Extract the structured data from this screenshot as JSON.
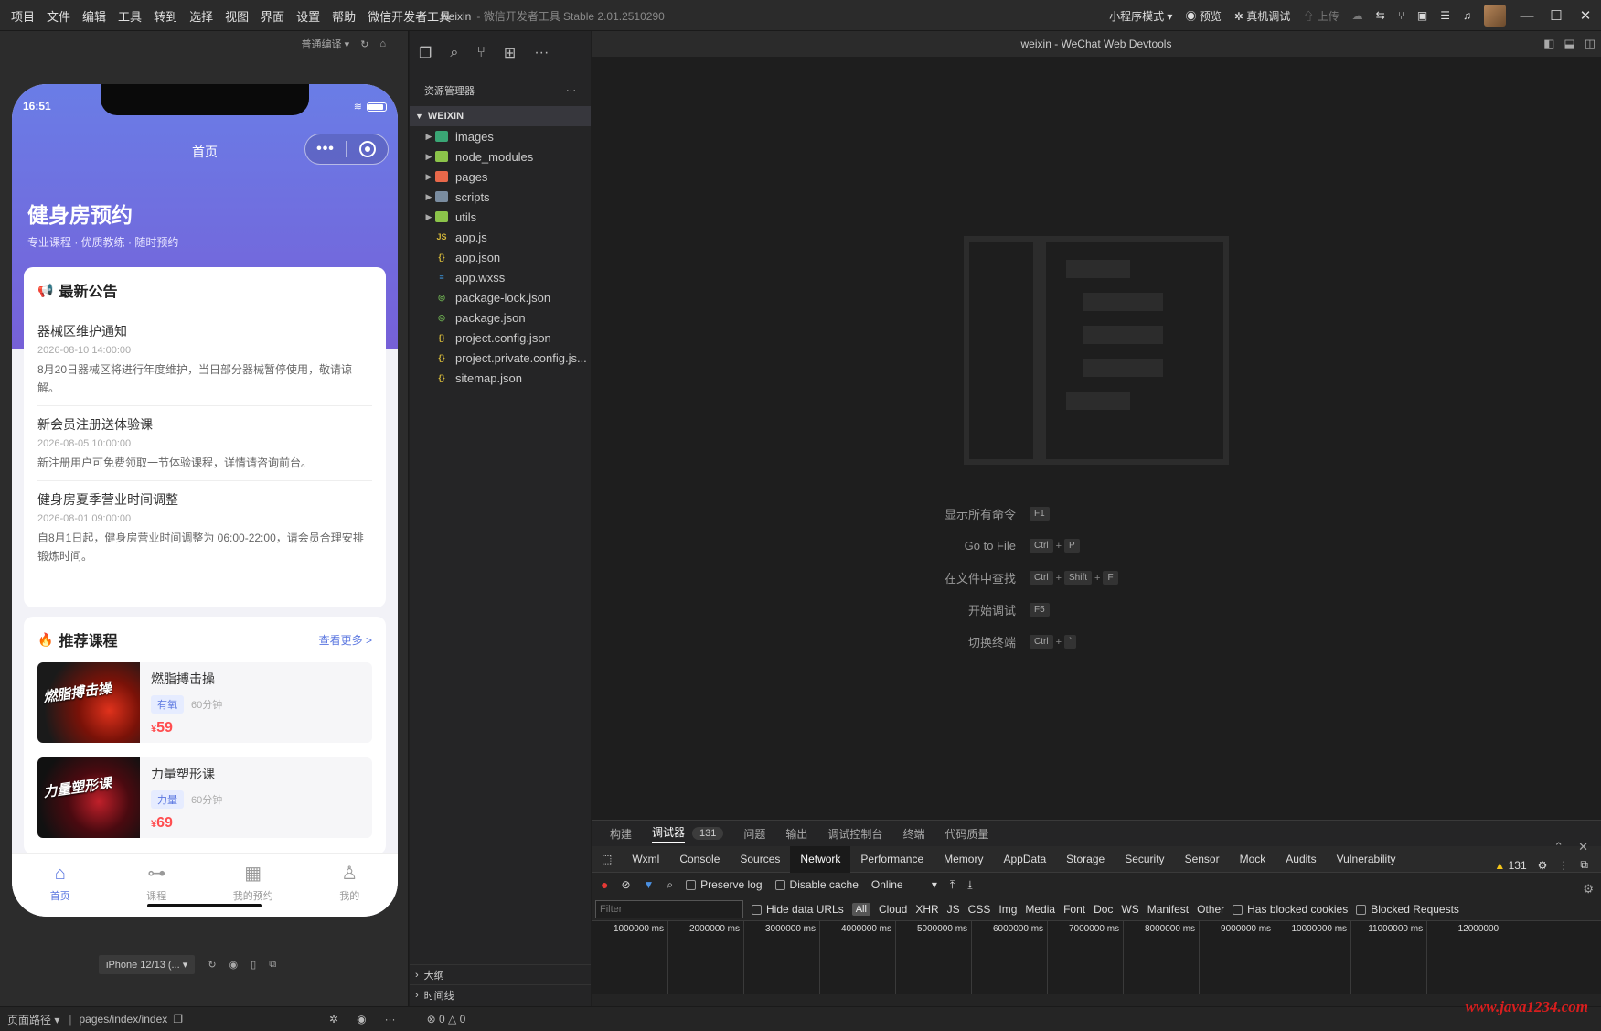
{
  "menu": [
    "项目",
    "文件",
    "编辑",
    "工具",
    "转到",
    "选择",
    "视图",
    "界面",
    "设置",
    "帮助",
    "微信开发者工具"
  ],
  "app_title": {
    "project": "weixin",
    "suffix": "- 微信开发者工具 Stable 2.01.2510290"
  },
  "titlebar_right": {
    "mode": "小程序模式",
    "preview": "预览",
    "real_debug": "真机调试",
    "upload": "上传"
  },
  "sim_toolbar": {
    "compile_mode": "普通编译"
  },
  "phone": {
    "time": "16:51",
    "nav_title": "首页",
    "hero_title": "健身房预约",
    "hero_sub": "专业课程 · 优质教练 · 随时预约",
    "notice_title": "最新公告",
    "notices": [
      {
        "title": "器械区维护通知",
        "date": "2026-08-10 14:00:00",
        "content": "8月20日器械区将进行年度维护，当日部分器械暂停使用，敬请谅解。"
      },
      {
        "title": "新会员注册送体验课",
        "date": "2026-08-05 10:00:00",
        "content": "新注册用户可免费领取一节体验课程，详情请咨询前台。"
      },
      {
        "title": "健身房夏季营业时间调整",
        "date": "2026-08-01 09:00:00",
        "content": "自8月1日起，健身房营业时间调整为 06:00-22:00，请会员合理安排锻炼时间。"
      }
    ],
    "course_title": "推荐课程",
    "more": "查看更多 >",
    "courses": [
      {
        "name": "燃脂搏击操",
        "tag": "有氧",
        "duration": "60分钟",
        "price": "59",
        "currency": "¥",
        "img_text": "燃脂搏击操"
      },
      {
        "name": "力量塑形课",
        "tag": "力量",
        "duration": "60分钟",
        "price": "69",
        "currency": "¥",
        "img_text": "力量塑形课"
      }
    ],
    "tabs": [
      {
        "label": "首页",
        "icon": "home-icon",
        "glyph": "⌂"
      },
      {
        "label": "课程",
        "icon": "dumbbell-icon",
        "glyph": "⊶"
      },
      {
        "label": "我的预约",
        "icon": "calendar-icon",
        "glyph": "▦"
      },
      {
        "label": "我的",
        "icon": "user-icon",
        "glyph": "♙"
      }
    ]
  },
  "sim_bottom": {
    "device": "iPhone 12/13 (..."
  },
  "statusbar": {
    "page_path_label": "页面路径",
    "page_path": "pages/index/index",
    "errors": "0",
    "warnings": "0"
  },
  "explorer": {
    "title": "资源管理器",
    "root": "WEIXIN",
    "items": [
      {
        "name": "images",
        "folder": true,
        "color": "#3aa675"
      },
      {
        "name": "node_modules",
        "folder": true,
        "color": "#8bc34a"
      },
      {
        "name": "pages",
        "folder": true,
        "color": "#e8684a"
      },
      {
        "name": "scripts",
        "folder": true,
        "color": "#7a8ca0"
      },
      {
        "name": "utils",
        "folder": true,
        "color": "#8bc34a"
      },
      {
        "name": "app.js",
        "folder": false,
        "color": "#d4b83a",
        "glyph": "JS"
      },
      {
        "name": "app.json",
        "folder": false,
        "color": "#d4b83a",
        "glyph": "{}"
      },
      {
        "name": "app.wxss",
        "folder": false,
        "color": "#3a8fd4",
        "glyph": "≡"
      },
      {
        "name": "package-lock.json",
        "folder": false,
        "color": "#6aa84f",
        "glyph": "◎"
      },
      {
        "name": "package.json",
        "folder": false,
        "color": "#6aa84f",
        "glyph": "◎"
      },
      {
        "name": "project.config.json",
        "folder": false,
        "color": "#d4b83a",
        "glyph": "{}"
      },
      {
        "name": "project.private.config.js...",
        "folder": false,
        "color": "#d4b83a",
        "glyph": "{}"
      },
      {
        "name": "sitemap.json",
        "folder": false,
        "color": "#d4b83a",
        "glyph": "{}"
      }
    ],
    "outline": "大纲",
    "timeline": "时间线"
  },
  "editor": {
    "title": "weixin - WeChat Web Devtools",
    "shortcuts": [
      {
        "label": "显示所有命令",
        "keys": [
          "F1"
        ]
      },
      {
        "label": "Go to File",
        "keys": [
          "Ctrl",
          "P"
        ]
      },
      {
        "label": "在文件中查找",
        "keys": [
          "Ctrl",
          "Shift",
          "F"
        ]
      },
      {
        "label": "开始调试",
        "keys": [
          "F5"
        ]
      },
      {
        "label": "切换终端",
        "keys": [
          "Ctrl",
          "`"
        ]
      }
    ]
  },
  "devtools": {
    "tabs": [
      "构建",
      "调试器",
      "问题",
      "输出",
      "调试控制台",
      "终端",
      "代码质量"
    ],
    "debugger_badge": "131",
    "cdt_tabs": [
      "Wxml",
      "Console",
      "Sources",
      "Network",
      "Performance",
      "Memory",
      "AppData",
      "Storage",
      "Security",
      "Sensor",
      "Mock",
      "Audits",
      "Vulnerability"
    ],
    "warn_count": "131",
    "preserve_log": "Preserve log",
    "disable_cache": "Disable cache",
    "throttle": "Online",
    "filter_placeholder": "Filter",
    "hide_data_urls": "Hide data URLs",
    "types": [
      "All",
      "Cloud",
      "XHR",
      "JS",
      "CSS",
      "Img",
      "Media",
      "Font",
      "Doc",
      "WS",
      "Manifest",
      "Other"
    ],
    "has_blocked": "Has blocked cookies",
    "blocked_requests": "Blocked Requests",
    "ticks": [
      "1000000 ms",
      "2000000 ms",
      "3000000 ms",
      "4000000 ms",
      "5000000 ms",
      "6000000 ms",
      "7000000 ms",
      "8000000 ms",
      "9000000 ms",
      "10000000 ms",
      "11000000 ms",
      "12000000"
    ]
  },
  "watermark": "www.java1234.com"
}
